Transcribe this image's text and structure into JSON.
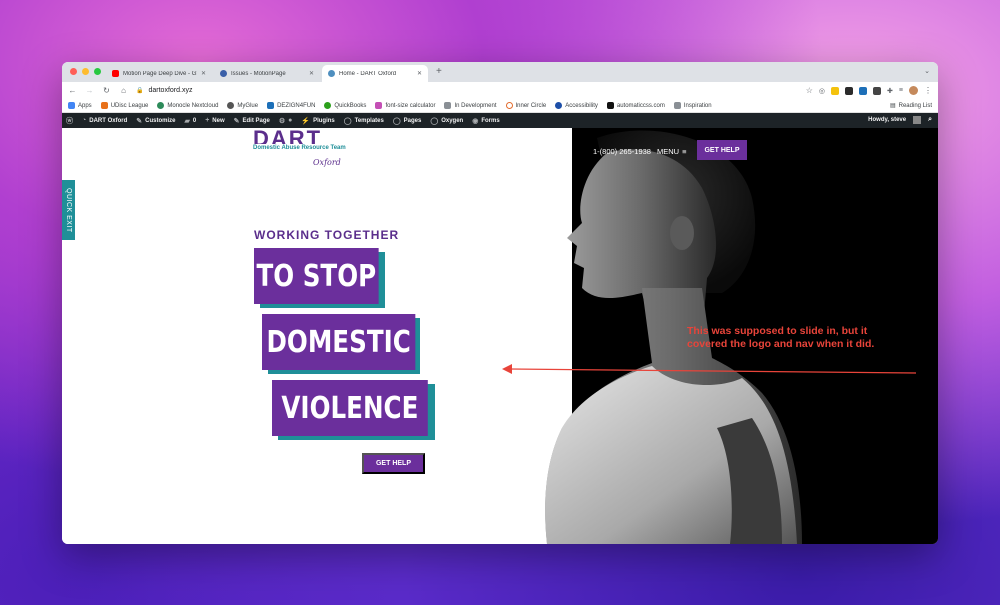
{
  "browser": {
    "tabs": [
      {
        "label": "Motion Page Deep Dive - GSAP",
        "icon": "youtube-icon"
      },
      {
        "label": "Issues - MotionPage",
        "icon": "wordpress-icon"
      },
      {
        "label": "Home - DART Oxford",
        "icon": "wordpress-icon",
        "active": true
      }
    ],
    "new_tab": "+",
    "url": "dartoxford.xyz",
    "bookmarks": [
      "Apps",
      "UDisc League",
      "Monocle Nextcloud",
      "MyGlue",
      "DEZIGN4FUN",
      "QuickBooks",
      "font-size calculator",
      "In Development",
      "Inner Circle",
      "Accessibility",
      "automaticcss.com",
      "Inspiration"
    ],
    "reading_list": "Reading List"
  },
  "wpbar": {
    "site": "DART Oxford",
    "customize": "Customize",
    "comments": "0",
    "new": "New",
    "edit": "Edit Page",
    "plugins": "Plugins",
    "templates": "Templates",
    "pages": "Pages",
    "oxygen": "Oxygen",
    "forms": "Forms",
    "howdy": "Howdy, steve"
  },
  "site": {
    "logo_word": "DART",
    "logo_sub": "Domestic Abuse Resource Team",
    "logo_script": "Oxford",
    "phone": "1-(800) 265-1938",
    "menu": "MENU",
    "nav_cta": "GET HELP",
    "quick_exit": "QUICK EXIT",
    "eyebrow": "WORKING TOGETHER",
    "headline": [
      "TO STOP",
      "DOMESTIC",
      "VIOLENCE"
    ],
    "cta": "GET HELP"
  },
  "annotation": {
    "text": "This was supposed to slide in, but it covered the logo and nav when it did.",
    "color": "#e8443a"
  },
  "colors": {
    "brand_purple": "#6b2f9c",
    "brand_teal": "#1f8f98"
  }
}
